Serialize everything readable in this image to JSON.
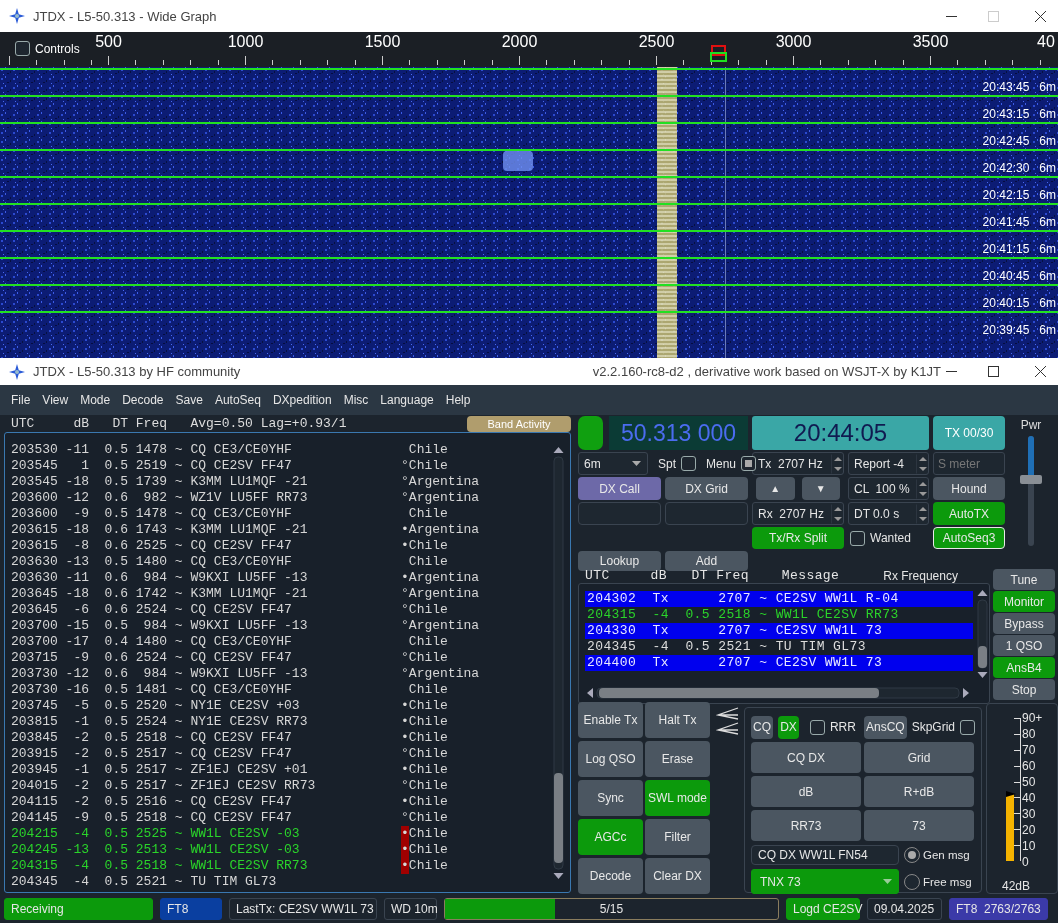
{
  "wide_graph": {
    "title": "JTDX - L5-50.313 - Wide Graph",
    "controls": {
      "label": "Controls",
      "checked": false
    },
    "scale": [
      "500",
      "1000",
      "1500",
      "2000",
      "2500",
      "3000",
      "3500",
      "40"
    ],
    "rows": [
      {
        "time": "20:43:45",
        "band": "6m"
      },
      {
        "time": "20:43:15",
        "band": "6m"
      },
      {
        "time": "20:42:45",
        "band": "6m"
      },
      {
        "time": "20:42:30",
        "band": "6m"
      },
      {
        "time": "20:42:15",
        "band": "6m"
      },
      {
        "time": "20:41:45",
        "band": "6m"
      },
      {
        "time": "20:41:15",
        "band": "6m"
      },
      {
        "time": "20:40:45",
        "band": "6m"
      },
      {
        "time": "20:40:15",
        "band": "6m"
      },
      {
        "time": "20:39:45",
        "band": "6m"
      }
    ]
  },
  "main_window": {
    "title": "JTDX - L5-50.313  by HF community",
    "version": "v2.2.160-rc8-d2 , derivative work based on WSJT-X by K1JT"
  },
  "menu": [
    "File",
    "View",
    "Mode",
    "Decode",
    "Save",
    "AutoSeq",
    "DXpedition",
    "Misc",
    "Language",
    "Help"
  ],
  "band_activity": {
    "header": "UTC     dB   DT Freq   Avg=0.50 Lag=+0.93/1",
    "button": "Band Activity",
    "rows": [
      {
        "text": "203530 -11  0.5 1478 ~ CQ CE3/CE0YHF",
        "country": "Chile",
        "highlight": false
      },
      {
        "text": "203545   1  0.5 2519 ~ CQ CE2SV FF47",
        "mark": "°",
        "country": "Chile",
        "highlight": false,
        "alert": false
      },
      {
        "text": "203545 -18  0.5 1739 ~ K3MM LU1MQF -21",
        "mark": "°",
        "country": "Argentina",
        "highlight": false,
        "alert": false
      },
      {
        "text": "203600 -12  0.6  982 ~ WZ1V LU5FF RR73",
        "mark": "°",
        "country": "Argentina",
        "highlight": false,
        "alert": false
      },
      {
        "text": "203600  -9  0.5 1478 ~ CQ CE3/CE0YHF",
        "country": "Chile",
        "highlight": false
      },
      {
        "text": "203615 -18  0.6 1743 ~ K3MM LU1MQF -21",
        "mark": "•",
        "country": "Argentina",
        "highlight": false,
        "alert": false
      },
      {
        "text": "203615  -8  0.6 2525 ~ CQ CE2SV FF47",
        "mark": "•",
        "country": "Chile",
        "highlight": false,
        "alert": false
      },
      {
        "text": "203630 -13  0.5 1480 ~ CQ CE3/CE0YHF",
        "country": "Chile",
        "highlight": false
      },
      {
        "text": "203630 -11  0.6  984 ~ W9KXI LU5FF -13",
        "mark": "•",
        "country": "Argentina",
        "highlight": false,
        "alert": false
      },
      {
        "text": "203645 -18  0.6 1742 ~ K3MM LU1MQF -21",
        "mark": "°",
        "country": "Argentina",
        "highlight": false,
        "alert": false
      },
      {
        "text": "203645  -6  0.6 2524 ~ CQ CE2SV FF47",
        "mark": "°",
        "country": "Chile",
        "highlight": false,
        "alert": false
      },
      {
        "text": "203700 -15  0.5  984 ~ W9KXI LU5FF -13",
        "mark": "°",
        "country": "Argentina",
        "highlight": false,
        "alert": false
      },
      {
        "text": "203700 -17  0.4 1480 ~ CQ CE3/CE0YHF",
        "country": "Chile",
        "highlight": false
      },
      {
        "text": "203715  -9  0.6 2524 ~ CQ CE2SV FF47",
        "mark": "°",
        "country": "Chile",
        "highlight": false,
        "alert": false
      },
      {
        "text": "203730 -12  0.6  984 ~ W9KXI LU5FF -13",
        "mark": "°",
        "country": "Argentina",
        "highlight": false,
        "alert": false
      },
      {
        "text": "203730 -16  0.5 1481 ~ CQ CE3/CE0YHF",
        "country": "Chile",
        "highlight": false
      },
      {
        "text": "203745  -5  0.5 2520 ~ NY1E CE2SV +03",
        "mark": "•",
        "country": "Chile",
        "highlight": false,
        "alert": false
      },
      {
        "text": "203815  -1  0.5 2524 ~ NY1E CE2SV RR73",
        "mark": "•",
        "country": "Chile",
        "highlight": false,
        "alert": false
      },
      {
        "text": "203845  -2  0.5 2518 ~ CQ CE2SV FF47",
        "mark": "•",
        "country": "Chile",
        "highlight": false,
        "alert": false
      },
      {
        "text": "203915  -2  0.5 2517 ~ CQ CE2SV FF47",
        "mark": "°",
        "country": "Chile",
        "highlight": false,
        "alert": false
      },
      {
        "text": "203945  -1  0.5 2517 ~ ZF1EJ CE2SV +01",
        "mark": "•",
        "country": "Chile",
        "highlight": false,
        "alert": false
      },
      {
        "text": "204015  -2  0.5 2517 ~ ZF1EJ CE2SV RR73",
        "mark": "°",
        "country": "Chile",
        "highlight": false,
        "alert": false
      },
      {
        "text": "204115  -2  0.5 2516 ~ CQ CE2SV FF47",
        "mark": "•",
        "country": "Chile",
        "highlight": false,
        "alert": false
      },
      {
        "text": "204145  -9  0.5 2518 ~ CQ CE2SV FF47",
        "mark": "°",
        "country": "Chile",
        "highlight": false,
        "alert": false
      },
      {
        "text": "204215  -4  0.5 2525 ~ WW1L CE2SV -03",
        "mark": "•",
        "country": "Chile",
        "highlight": true,
        "alert": true
      },
      {
        "text": "204245 -13  0.5 2513 ~ WW1L CE2SV -03",
        "mark": "•",
        "country": "Chile",
        "highlight": true,
        "alert": true
      },
      {
        "text": "204315  -4  0.5 2518 ~ WW1L CE2SV RR73",
        "mark": "•",
        "country": "Chile",
        "highlight": true,
        "alert": true
      },
      {
        "text": "204345  -4  0.5 2521 ~ TU TIM GL73",
        "highlight": false
      }
    ]
  },
  "controls": {
    "indicator": {
      "on": true
    },
    "frequency": "50.313 000",
    "clock": "20:44:05",
    "tx_counter": "TX 00/30",
    "band": "6m",
    "spt": {
      "label": "Spt",
      "checked": false
    },
    "menu": {
      "label": "Menu",
      "checked": true
    },
    "tx_freq": "Tx  2707 Hz",
    "report": "Report -4",
    "s_meter": "S meter",
    "dx_call": {
      "label": "DX Call",
      "selected": true
    },
    "dx_grid": {
      "label": "DX Grid",
      "selected": false
    },
    "up": "▲",
    "down": "▼",
    "cl": "CL  100 %",
    "hound": {
      "label": "Hound",
      "on": false
    },
    "rx_freq": "Rx  2707 Hz",
    "dt": "DT 0.0 s",
    "autotx": {
      "label": "AutoTX",
      "on": true
    },
    "split": {
      "label": "Tx/Rx Split",
      "on": true
    },
    "wanted": {
      "label": "Wanted",
      "checked": false
    },
    "autoseq": {
      "label": "AutoSeq3",
      "on": true
    },
    "lookup": "Lookup",
    "add": "Add",
    "power": {
      "label": "Pwr",
      "level": 0.6
    }
  },
  "rx_frequency": {
    "columns": "UTC     dB   DT Freq    Message",
    "title": "Rx Frequency",
    "rows": [
      {
        "text": "204302  Tx      2707 ~ CE2SV WW1L R-04",
        "kind": "tx",
        "highlight": false
      },
      {
        "text": "204315  -4  0.5 2518 ~ WW1L CE2SV RR73",
        "kind": "rx",
        "highlight": true
      },
      {
        "text": "204330  Tx      2707 ~ CE2SV WW1L 73",
        "kind": "tx",
        "highlight": false
      },
      {
        "text": "204345  -4  0.5 2521 ~ TU TIM GL73",
        "kind": "rx",
        "highlight": false
      },
      {
        "text": "204400  Tx      2707 ~ CE2SV WW1L 73",
        "kind": "tx",
        "highlight": false
      }
    ]
  },
  "side_buttons": [
    {
      "label": "Tune",
      "on": false
    },
    {
      "label": "Monitor",
      "on": true
    },
    {
      "label": "Bypass",
      "on": false
    },
    {
      "label": "1 QSO",
      "on": false
    },
    {
      "label": "AnsB4",
      "on": true
    },
    {
      "label": "Stop",
      "on": false
    }
  ],
  "tx_buttons": [
    {
      "label": "Enable Tx",
      "on": false
    },
    {
      "label": "Halt Tx",
      "on": false
    },
    {
      "label": "Log QSO",
      "on": false
    },
    {
      "label": "Erase",
      "on": false
    },
    {
      "label": "Sync",
      "on": false
    },
    {
      "label": "SWL mode",
      "on": true
    },
    {
      "label": "AGCc",
      "on": true
    },
    {
      "label": "Filter",
      "on": false
    },
    {
      "label": "Decode",
      "on": false
    },
    {
      "label": "Clear DX",
      "on": false
    }
  ],
  "messages": {
    "cq": {
      "label": "CQ",
      "selected": false
    },
    "dx": {
      "label": "DX",
      "selected": true
    },
    "rrr": {
      "label": "RRR",
      "checked": false
    },
    "anscq": {
      "label": "AnsCQ",
      "on": false
    },
    "skpgrid": {
      "label": "SkpGrid",
      "checked": false
    },
    "buttons": [
      "CQ DX",
      "Grid",
      "dB",
      "R+dB",
      "RR73",
      "73"
    ],
    "generated": "CQ DX WW1L FN54",
    "free": "TNX 73",
    "gen_msg": {
      "label": "Gen msg",
      "selected": true
    },
    "free_msg": {
      "label": "Free msg",
      "selected": false
    }
  },
  "meter": {
    "scale": [
      "90+",
      "80",
      "70",
      "60",
      "50",
      "40",
      "30",
      "20",
      "10",
      "0"
    ],
    "level": 0.467,
    "reading": "42dB"
  },
  "status_bar": {
    "state": "Receiving",
    "mode": "FT8",
    "last_tx": "LastTx: CE2SV WW1L 73",
    "watchdog": "WD 10m",
    "progress": {
      "text": "5/15",
      "level": 0.33
    },
    "logged": "Logd CE2SV",
    "date": "09.04.2025",
    "counter": "FT8  2763/2763"
  }
}
